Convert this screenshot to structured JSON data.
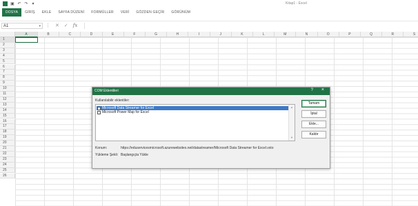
{
  "titlebar": {
    "window_title": "Kitap1 - Excel"
  },
  "qat": {
    "logo": "excel-logo-icon",
    "save": "save-icon",
    "undo": "undo-icon",
    "redo": "redo-icon",
    "customize": "customize-qat-icon"
  },
  "ribbon": {
    "tabs": [
      "DOSYA",
      "GİRİŞ",
      "EKLE",
      "SAYFA DÜZENİ",
      "FORMÜLLER",
      "VERİ",
      "GÖZDEN GEÇİR",
      "GÖRÜNÜM"
    ]
  },
  "formula_bar": {
    "name_box": "A1",
    "fx": "fx",
    "value": ""
  },
  "grid": {
    "columns": [
      "A",
      "B",
      "C",
      "D",
      "E",
      "F",
      "G",
      "H",
      "I",
      "J",
      "K",
      "L",
      "M",
      "N",
      "O",
      "P",
      "Q",
      "R",
      "S"
    ],
    "rows": [
      "1",
      "2",
      "3",
      "4",
      "5",
      "6",
      "7",
      "8",
      "9",
      "10",
      "11",
      "12",
      "13",
      "14",
      "15",
      "16",
      "17",
      "18",
      "19",
      "20",
      "21",
      "22",
      "23",
      "24",
      "25",
      "26"
    ],
    "selected_cell": "A1"
  },
  "dialog": {
    "title": "COM Eklentileri",
    "help": "?",
    "close": "×",
    "addins_label": "Kullanılabilir eklentiler:",
    "addins": [
      {
        "label": "Microsoft Data Streamer for Excel",
        "checked": false,
        "selected": true
      },
      {
        "label": "Microsoft Power Map for Excel",
        "checked": false,
        "selected": false
      }
    ],
    "buttons": {
      "ok": "Tamam",
      "cancel": "İptal",
      "add": "Ekle...",
      "remove": "Kaldır"
    },
    "location_label": "Konum:",
    "location_value": "https://eduservicesmicrosoft.azurewebsites.net/datastreamer/Microsoft Data Streamer for Excel.vsto",
    "load_behavior_label": "Yükleme Şekli:",
    "load_behavior_value": "Başlangıçta Yükle"
  }
}
